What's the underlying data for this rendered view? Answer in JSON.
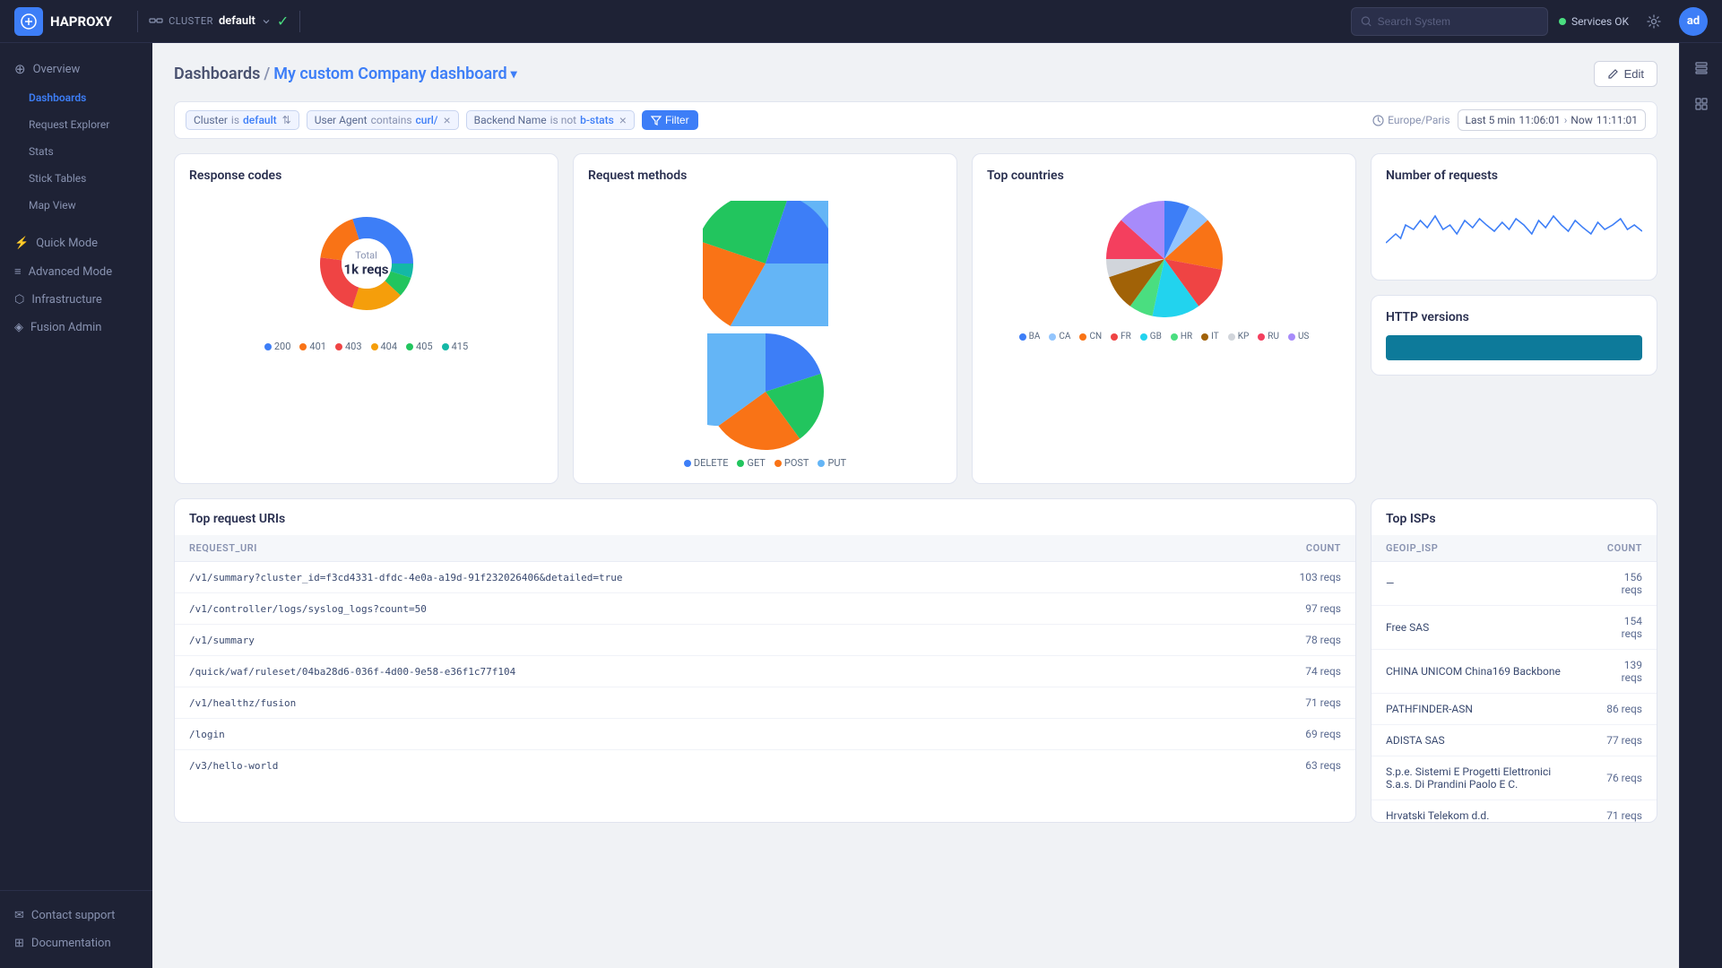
{
  "topNav": {
    "logoText": "HAPROXY",
    "clusterLabel": "CLUSTER",
    "clusterName": "default",
    "clusterStatus": "✓",
    "searchPlaceholder": "Search System",
    "servicesOk": "Services OK",
    "avatarInitials": "ad"
  },
  "sidebar": {
    "sections": [
      {
        "label": "",
        "items": [
          {
            "id": "overview",
            "label": "Overview",
            "icon": "⊕",
            "active": true,
            "sub": false
          },
          {
            "id": "dashboards",
            "label": "Dashboards",
            "icon": "",
            "active": true,
            "sub": true
          },
          {
            "id": "request-explorer",
            "label": "Request Explorer",
            "icon": "",
            "active": false,
            "sub": true
          },
          {
            "id": "stats",
            "label": "Stats",
            "icon": "",
            "active": false,
            "sub": true
          },
          {
            "id": "stick-tables",
            "label": "Stick Tables",
            "icon": "",
            "active": false,
            "sub": true
          },
          {
            "id": "map-view",
            "label": "Map View",
            "icon": "",
            "active": false,
            "sub": true
          }
        ]
      },
      {
        "label": "",
        "items": [
          {
            "id": "quick-mode",
            "label": "Quick Mode",
            "icon": "⚡",
            "active": false,
            "sub": false
          },
          {
            "id": "advanced-mode",
            "label": "Advanced Mode",
            "icon": "≡",
            "active": false,
            "sub": false
          },
          {
            "id": "infrastructure",
            "label": "Infrastructure",
            "icon": "⬡",
            "active": false,
            "sub": false
          },
          {
            "id": "fusion-admin",
            "label": "Fusion Admin",
            "icon": "◈",
            "active": false,
            "sub": false
          }
        ]
      }
    ],
    "bottomItems": [
      {
        "id": "contact-support",
        "label": "Contact support",
        "icon": "✉"
      },
      {
        "id": "documentation",
        "label": "Documentation",
        "icon": "⊞"
      }
    ]
  },
  "page": {
    "breadcrumbParent": "Dashboards",
    "breadcrumbCurrent": "My custom Company dashboard",
    "editLabel": "Edit"
  },
  "filterBar": {
    "filters": [
      {
        "key": "Cluster",
        "op": "is",
        "val": "default",
        "hasSort": true
      },
      {
        "key": "User Agent",
        "op": "contains",
        "val": "curl/",
        "hasSort": false
      },
      {
        "key": "Backend Name",
        "op": "is not",
        "val": "b-stats",
        "hasSort": false
      }
    ],
    "filterBtnLabel": "Filter",
    "timezone": "Europe/Paris",
    "timeRange": "Last 5 min",
    "timeStart": "11:06:01",
    "timeEnd": "Now",
    "timeEndValue": "11:11:01"
  },
  "widgets": {
    "responseCodes": {
      "title": "Response codes",
      "total": "Total",
      "totalValue": "1k reqs",
      "segments": [
        {
          "label": "200",
          "color": "#3d7ef7",
          "percent": 30
        },
        {
          "label": "401",
          "color": "#f97316",
          "percent": 18
        },
        {
          "label": "403",
          "color": "#ef4444",
          "percent": 22
        },
        {
          "label": "404",
          "color": "#f59e0b",
          "percent": 18
        },
        {
          "label": "405",
          "color": "#22c55e",
          "percent": 7
        },
        {
          "label": "415",
          "color": "#14b8a6",
          "percent": 5
        }
      ]
    },
    "requestMethods": {
      "title": "Request methods",
      "segments": [
        {
          "label": "DELETE",
          "color": "#3d7ef7",
          "percent": 20
        },
        {
          "label": "GET",
          "color": "#22c55e",
          "percent": 25
        },
        {
          "label": "POST",
          "color": "#f97316",
          "percent": 22
        },
        {
          "label": "PUT",
          "color": "#64b5f6",
          "percent": 33
        }
      ]
    },
    "topCountries": {
      "title": "Top countries",
      "segments": [
        {
          "label": "BA",
          "color": "#3d7ef7",
          "percent": 8
        },
        {
          "label": "CA",
          "color": "#93c5fd",
          "percent": 6
        },
        {
          "label": "CN",
          "color": "#f97316",
          "percent": 14
        },
        {
          "label": "FR",
          "color": "#ef4444",
          "percent": 16
        },
        {
          "label": "GB",
          "color": "#22d3ee",
          "percent": 10
        },
        {
          "label": "HR",
          "color": "#4ade80",
          "percent": 6
        },
        {
          "label": "IT",
          "color": "#a16207",
          "percent": 8
        },
        {
          "label": "KP",
          "color": "#d1d5db",
          "percent": 5
        },
        {
          "label": "RU",
          "color": "#f43f5e",
          "percent": 12
        },
        {
          "label": "US",
          "color": "#a78bfa",
          "percent": 15
        }
      ]
    },
    "numberOfRequests": {
      "title": "Number of requests",
      "chartColor": "#3d7ef7"
    },
    "httpVersions": {
      "title": "HTTP versions",
      "barColor": "#0d7a9a",
      "barWidthPercent": 100
    }
  },
  "topRequestUris": {
    "title": "Top request URIs",
    "columns": [
      {
        "id": "uri",
        "label": "REQUEST_URI"
      },
      {
        "id": "count",
        "label": "COUNT"
      }
    ],
    "rows": [
      {
        "uri": "/v1/summary?cluster_id=f3cd4331-dfdc-4e0a-a19d-91f232026406&detailed=true",
        "count": "103 reqs"
      },
      {
        "uri": "/v1/controller/logs/syslog_logs?count=50",
        "count": "97 reqs"
      },
      {
        "uri": "/v1/summary",
        "count": "78 reqs"
      },
      {
        "uri": "/quick/waf/ruleset/04ba28d6-036f-4d00-9e58-e36f1c77f104",
        "count": "74 reqs"
      },
      {
        "uri": "/v1/healthz/fusion",
        "count": "71 reqs"
      },
      {
        "uri": "/login",
        "count": "69 reqs"
      },
      {
        "uri": "/v3/hello-world",
        "count": "63 reqs"
      }
    ]
  },
  "topIsps": {
    "title": "Top ISPs",
    "columns": [
      {
        "id": "isp",
        "label": "GEOIP_ISP"
      },
      {
        "id": "count",
        "label": "COUNT"
      }
    ],
    "rows": [
      {
        "isp": "—",
        "count": "156 reqs"
      },
      {
        "isp": "Free SAS",
        "count": "154 reqs"
      },
      {
        "isp": "CHINA UNICOM China169 Backbone",
        "count": "139 reqs"
      },
      {
        "isp": "PATHFINDER-ASN",
        "count": "86 reqs"
      },
      {
        "isp": "ADISTA SAS",
        "count": "77 reqs"
      },
      {
        "isp": "S.p.e. Sistemi E Progetti Elettronici S.a.s. Di Prandini Paolo E C.",
        "count": "76 reqs"
      },
      {
        "isp": "Hrvatski Telekom d.d.",
        "count": "71 reqs"
      }
    ]
  }
}
